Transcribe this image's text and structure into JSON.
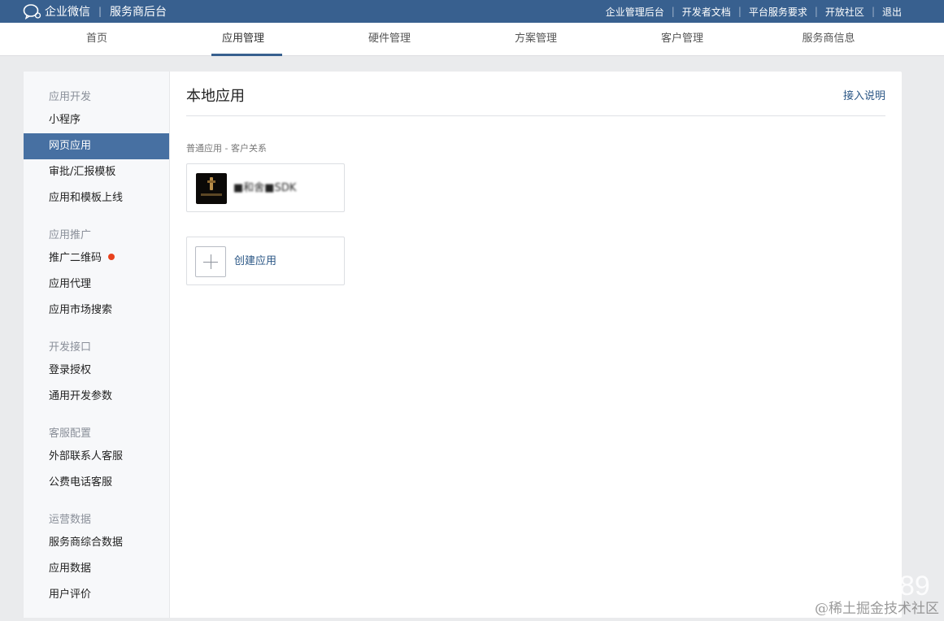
{
  "brand": {
    "name": "企业微信",
    "subtitle": "服务商后台"
  },
  "top_links": [
    "企业管理后台",
    "开发者文档",
    "平台服务要求",
    "开放社区",
    "退出"
  ],
  "nav_tabs": [
    {
      "label": "首页",
      "active": false
    },
    {
      "label": "应用管理",
      "active": true
    },
    {
      "label": "硬件管理",
      "active": false
    },
    {
      "label": "方案管理",
      "active": false
    },
    {
      "label": "客户管理",
      "active": false
    },
    {
      "label": "服务商信息",
      "active": false
    }
  ],
  "sidebar": {
    "sections": [
      {
        "title": "应用开发",
        "items": [
          "小程序",
          "网页应用",
          "审批/汇报模板",
          "应用和模板上线"
        ]
      },
      {
        "title": "应用推广",
        "items": [
          "推广二维码",
          "应用代理",
          "应用市场搜索"
        ]
      },
      {
        "title": "开发接口",
        "items": [
          "登录授权",
          "通用开发参数"
        ]
      },
      {
        "title": "客服配置",
        "items": [
          "外部联系人客服",
          "公费电话客服"
        ]
      },
      {
        "title": "运营数据",
        "items": [
          "服务商综合数据",
          "应用数据",
          "用户评价"
        ]
      }
    ],
    "active_item": "网页应用",
    "badge_item": "推广二维码"
  },
  "main": {
    "title": "本地应用",
    "help_link": "接入说明",
    "group_label": "普通应用 - 客户关系",
    "app_card": {
      "name": "■和舍■SDK"
    },
    "create_card": {
      "label": "创建应用"
    }
  },
  "watermark": {
    "text": "@稀土掘金技术社区",
    "number": "89"
  },
  "colors": {
    "topbar": "#38608f",
    "active_item": "#4770a2",
    "link": "#2a5685",
    "badge": "#e8421d"
  }
}
